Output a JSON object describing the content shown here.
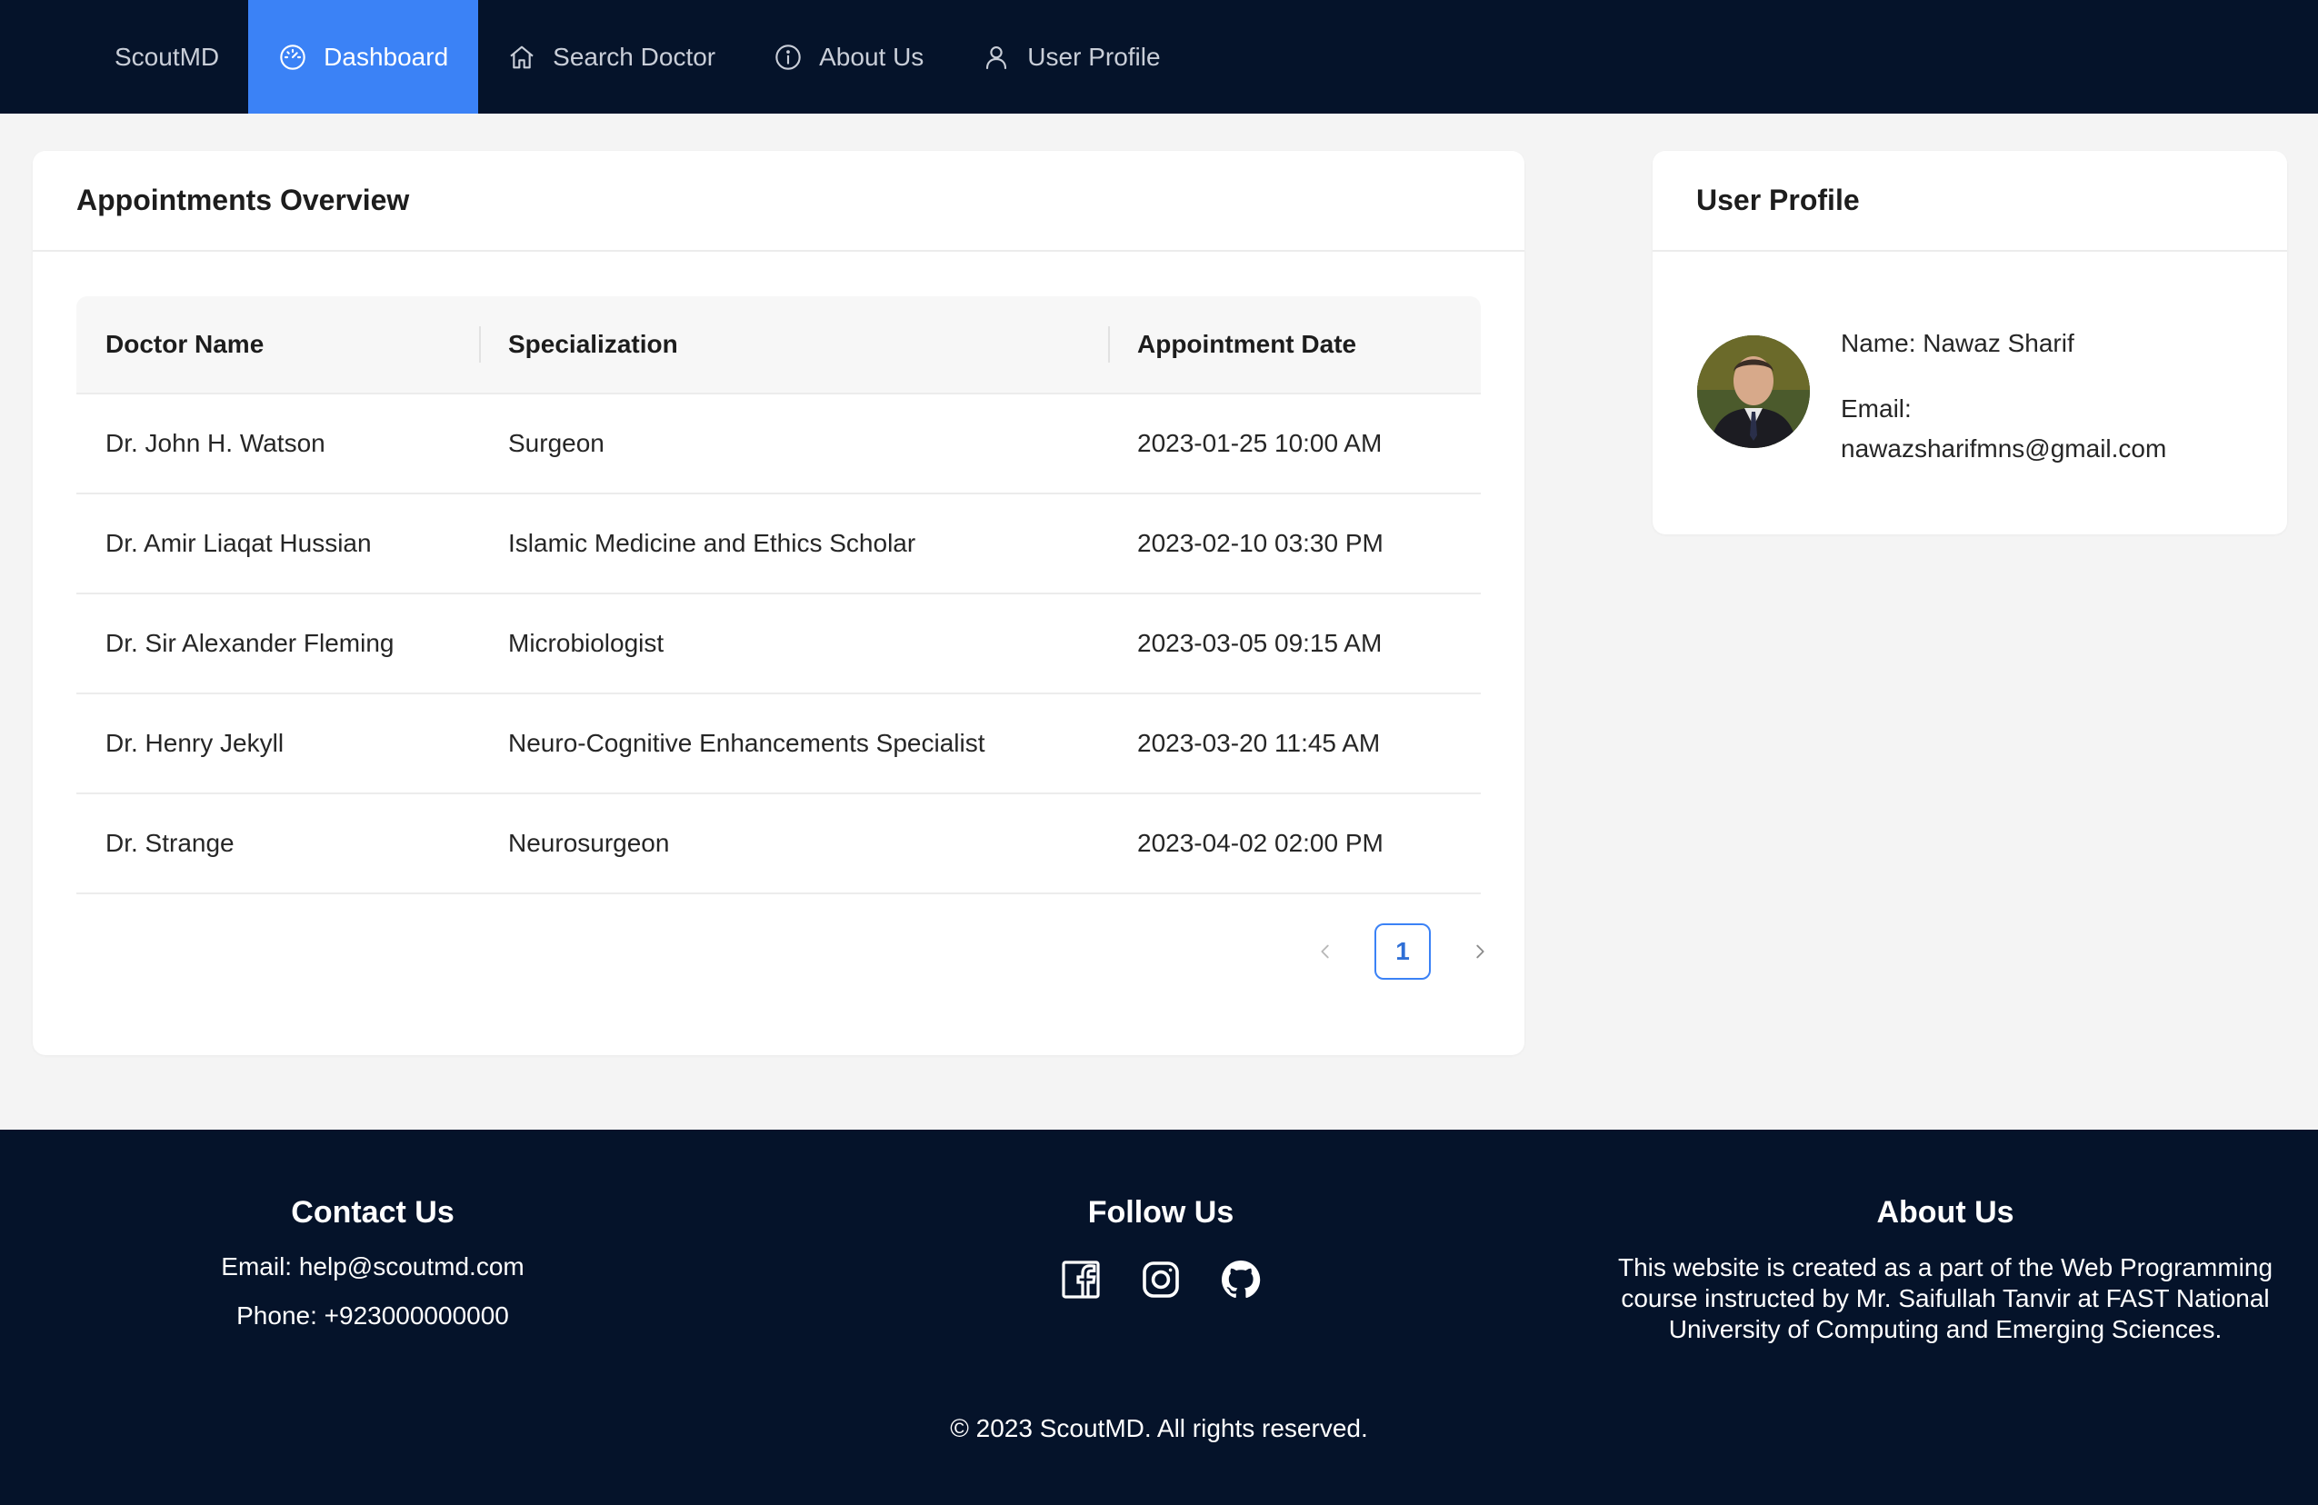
{
  "nav": {
    "brand": "ScoutMD",
    "items": [
      {
        "label": "Dashboard",
        "icon": "dashboard-icon",
        "active": true
      },
      {
        "label": "Search Doctor",
        "icon": "home-icon",
        "active": false
      },
      {
        "label": "About Us",
        "icon": "info-icon",
        "active": false
      },
      {
        "label": "User Profile",
        "icon": "user-icon",
        "active": false
      }
    ]
  },
  "appointments": {
    "title": "Appointments Overview",
    "columns": [
      "Doctor Name",
      "Specialization",
      "Appointment Date"
    ],
    "rows": [
      {
        "doctor": "Dr. John H. Watson",
        "specialization": "Surgeon",
        "date": "2023-01-25 10:00 AM"
      },
      {
        "doctor": "Dr. Amir Liaqat Hussian",
        "specialization": "Islamic Medicine and Ethics Scholar",
        "date": "2023-02-10 03:30 PM"
      },
      {
        "doctor": "Dr. Sir Alexander Fleming",
        "specialization": "Microbiologist",
        "date": "2023-03-05 09:15 AM"
      },
      {
        "doctor": "Dr. Henry Jekyll",
        "specialization": "Neuro-Cognitive Enhancements Specialist",
        "date": "2023-03-20 11:45 AM"
      },
      {
        "doctor": "Dr. Strange",
        "specialization": "Neurosurgeon",
        "date": "2023-04-02 02:00 PM"
      }
    ],
    "pagination": {
      "current_page": "1",
      "prev_icon": "chevron-left-icon",
      "next_icon": "chevron-right-icon"
    }
  },
  "profile": {
    "title": "User Profile",
    "name_line": "Name: Nawaz Sharif",
    "email_label": "Email:",
    "email": "nawazsharifmns@gmail.com"
  },
  "footer": {
    "contact": {
      "title": "Contact Us",
      "email_line": "Email: help@scoutmd.com",
      "phone_line": "Phone: +923000000000"
    },
    "follow": {
      "title": "Follow Us",
      "icons": [
        "facebook-icon",
        "instagram-icon",
        "github-icon"
      ]
    },
    "about": {
      "title": "About Us",
      "text": "This website is created as a part of the Web Programming course instructed by Mr. Saifullah Tanvir at FAST National University of Computing and Emerging Sciences."
    },
    "copyright": "© 2023 ScoutMD. All rights reserved."
  },
  "colors": {
    "nav_bg": "#05132a",
    "accent": "#3b82f6",
    "page_bg": "#f4f4f4"
  }
}
